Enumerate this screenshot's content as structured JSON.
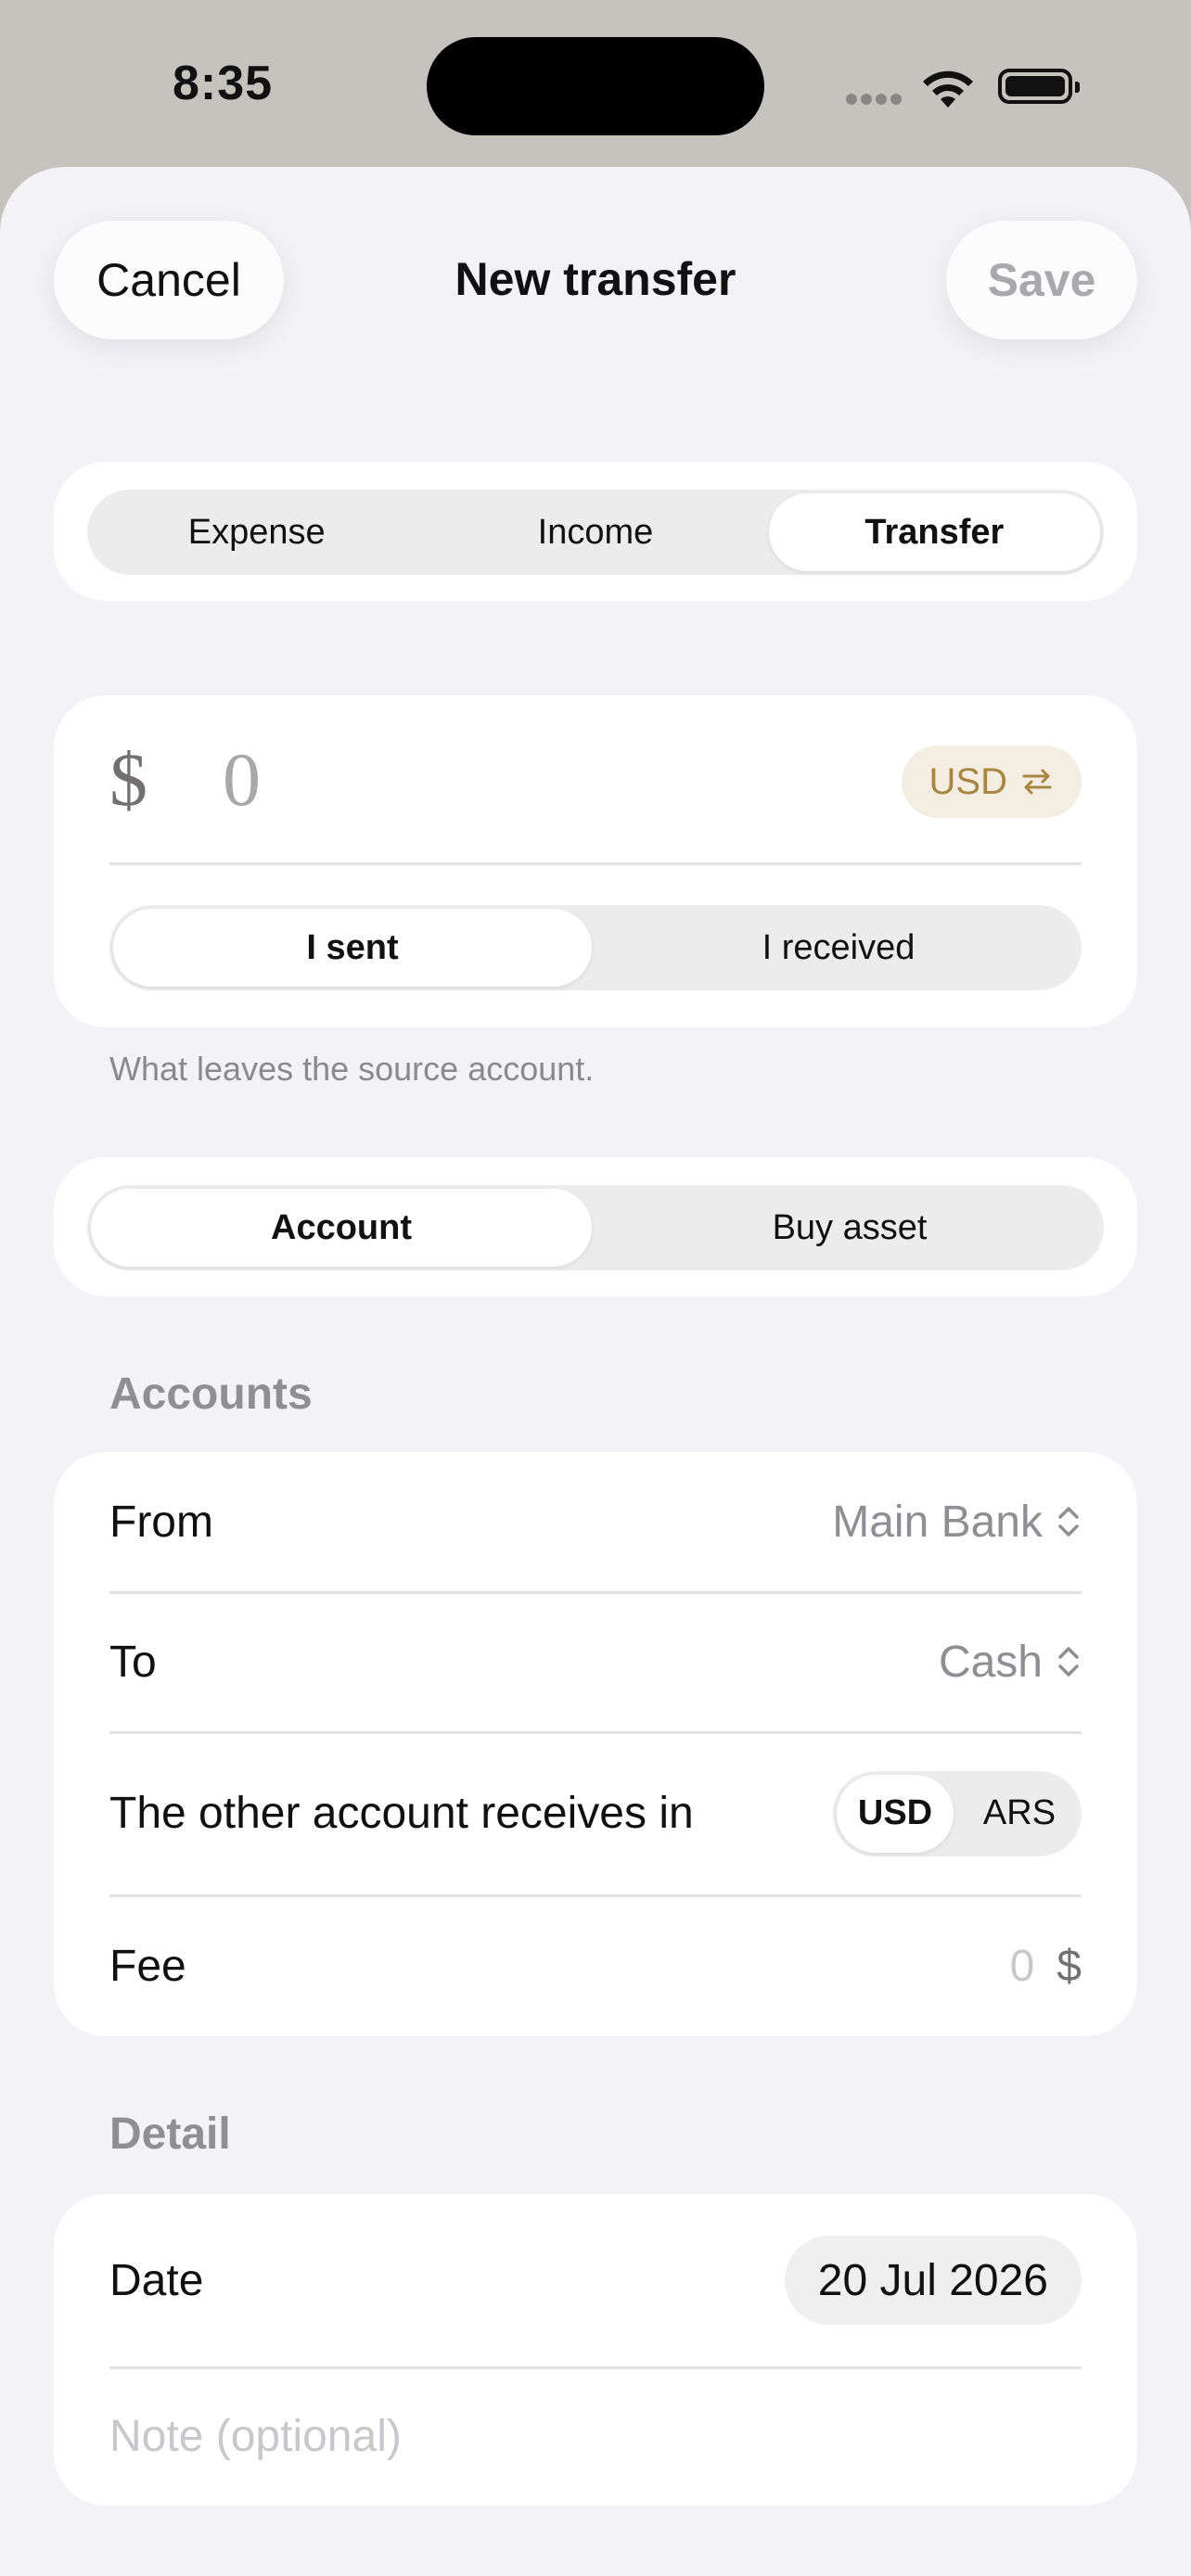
{
  "status": {
    "time": "8:35"
  },
  "nav": {
    "cancel": "Cancel",
    "title": "New transfer",
    "save": "Save"
  },
  "type_tabs": [
    "Expense",
    "Income",
    "Transfer"
  ],
  "amount": {
    "symbol": "$",
    "value": "0",
    "currency": "USD"
  },
  "direction": {
    "options": [
      "I sent",
      "I received"
    ],
    "hint": "What leaves the source account."
  },
  "destination": {
    "options": [
      "Account",
      "Buy asset"
    ]
  },
  "accounts": {
    "label": "Accounts",
    "from_label": "From",
    "from_value": "Main Bank",
    "to_label": "To",
    "to_value": "Cash",
    "receives_label": "The other account receives in",
    "receives_options": [
      "USD",
      "ARS"
    ],
    "fee_label": "Fee",
    "fee_value": "0",
    "fee_symbol": "$"
  },
  "detail": {
    "label": "Detail",
    "date_label": "Date",
    "date_value": "20 Jul 2026",
    "note_placeholder": "Note (optional)"
  }
}
